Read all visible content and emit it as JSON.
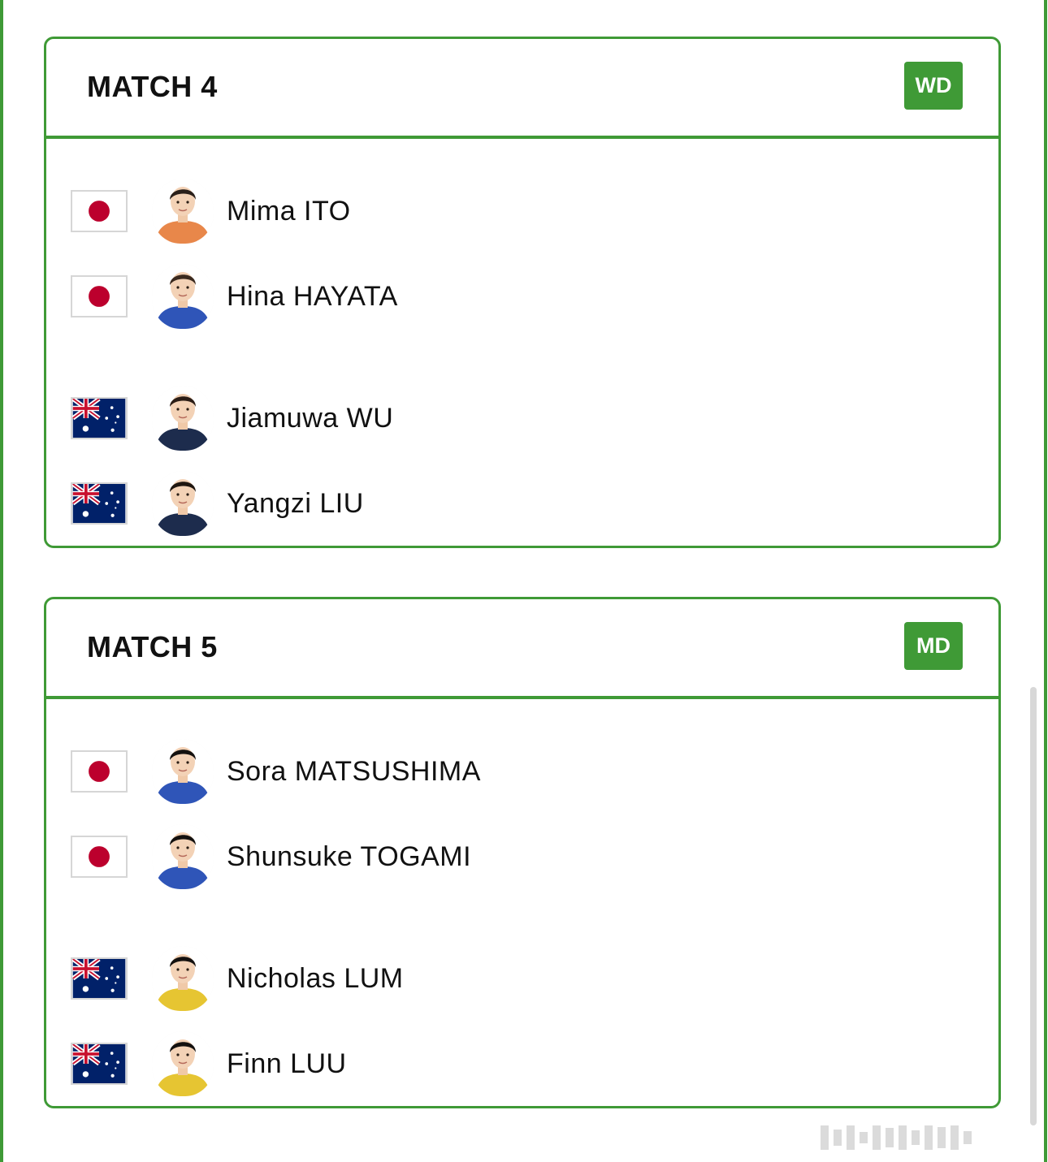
{
  "matches": [
    {
      "title": "MATCH 4",
      "badge": "WD",
      "players": [
        {
          "name": "Mima ITO",
          "flag": "japan-flag",
          "jersey": "#e8874a",
          "hair": "#2a201a"
        },
        {
          "name": "Hina HAYATA",
          "flag": "japan-flag",
          "jersey": "#2f55b8",
          "hair": "#3b2a1f"
        },
        {
          "name": "Jiamuwa WU",
          "flag": "australia-flag",
          "jersey": "#1d2c4d",
          "hair": "#2b1d16"
        },
        {
          "name": "Yangzi LIU",
          "flag": "australia-flag",
          "jersey": "#1d2c4d",
          "hair": "#1f1610"
        }
      ]
    },
    {
      "title": "MATCH 5",
      "badge": "MD",
      "players": [
        {
          "name": "Sora MATSUSHIMA",
          "flag": "japan-flag",
          "jersey": "#2f55b8",
          "hair": "#14110f"
        },
        {
          "name": "Shunsuke TOGAMI",
          "flag": "japan-flag",
          "jersey": "#2f55b8",
          "hair": "#14110f"
        },
        {
          "name": "Nicholas LUM",
          "flag": "australia-flag",
          "jersey": "#e6c532",
          "hair": "#14110f"
        },
        {
          "name": "Finn LUU",
          "flag": "australia-flag",
          "jersey": "#e6c532",
          "hair": "#14110f"
        }
      ]
    }
  ],
  "colors": {
    "accent": "#3f9a36",
    "japan_red": "#bc002d",
    "australia_blue": "#012169"
  }
}
